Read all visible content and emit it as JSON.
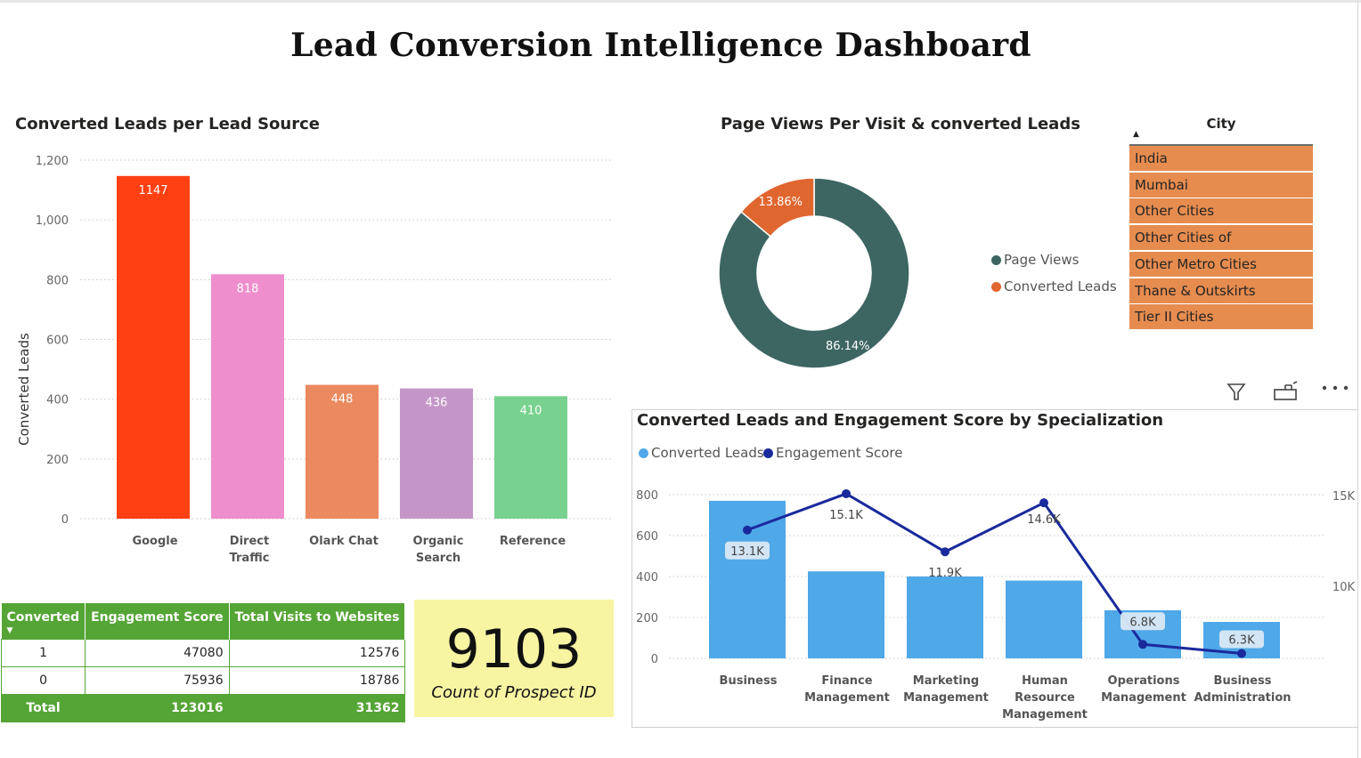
{
  "dashboard_title": "Lead Conversion Intelligence Dashboard",
  "lead_source_chart": {
    "title": "Converted Leads per Lead Source",
    "ylabel": "Converted Leads"
  },
  "donut_chart": {
    "title": "Page Views Per Visit & converted Leads"
  },
  "specialization_chart": {
    "title": "Converted Leads and Engagement Score by Specialization"
  },
  "city_slicer": {
    "title": "City",
    "items": [
      "India",
      "Mumbai",
      "Other Cities",
      "Other Cities of Maharashtra",
      "Other Metro Cities",
      "Thane & Outskirts",
      "Tier II Cities"
    ],
    "color": "#e68c4f"
  },
  "matrix": {
    "headers": [
      "Converted",
      "Engagement Score",
      "Total Visits to Websites"
    ],
    "rows": [
      {
        "key": "1",
        "engagement": "47080",
        "visits": "12576"
      },
      {
        "key": "0",
        "engagement": "75936",
        "visits": "18786"
      }
    ],
    "total": {
      "key": "Total",
      "engagement": "123016",
      "visits": "31362"
    },
    "header_color": "#55a536"
  },
  "card": {
    "value": "9103",
    "label": "Count of Prospect ID",
    "background": "#f7f4a2"
  },
  "toolbar_icons": [
    "filter-icon",
    "focus-mode-icon",
    "more-options-icon"
  ],
  "chart_data": [
    {
      "type": "bar",
      "title": "Converted Leads per Lead Source",
      "xlabel": "",
      "ylabel": "Converted Leads",
      "categories": [
        "Google",
        "Direct Traffic",
        "Olark Chat",
        "Organic Search",
        "Reference"
      ],
      "values": [
        1147,
        818,
        448,
        436,
        410
      ],
      "data_labels": [
        "1147",
        "818",
        "448",
        "436",
        "410"
      ],
      "colors": [
        "#ff4013",
        "#ef8ecd",
        "#ea8a5e",
        "#c496c8",
        "#78d18e"
      ],
      "ylim": [
        0,
        1200
      ],
      "yticks": [
        0,
        200,
        400,
        600,
        800,
        1000,
        1200
      ],
      "ytick_labels": [
        "0",
        "200",
        "400",
        "600",
        "800",
        "1,000",
        "1,200"
      ],
      "grid": true
    },
    {
      "type": "pie",
      "title": "Page Views Per Visit & converted Leads",
      "donut": true,
      "categories": [
        "Page Views",
        "Converted Leads"
      ],
      "values": [
        86.14,
        13.86
      ],
      "data_labels": [
        "86.14%",
        "13.86%"
      ],
      "colors": [
        "#3d6663",
        "#e0662f"
      ],
      "legend": "right"
    },
    {
      "type": "bar",
      "title": "Converted Leads and Engagement Score by Specialization",
      "categories": [
        "Business",
        "Finance Management",
        "Marketing Management",
        "Human Resource Management",
        "Operations Management",
        "Business Administration"
      ],
      "series": [
        {
          "name": "Converted Leads",
          "type": "bar",
          "axis": "left",
          "values": [
            770,
            425,
            400,
            380,
            235,
            178
          ],
          "color": "#4fa8e8"
        },
        {
          "name": "Engagement Score",
          "type": "line",
          "axis": "right",
          "values": [
            13100,
            15100,
            11900,
            14600,
            6800,
            6300
          ],
          "data_labels": [
            "13.1K",
            "15.1K",
            "11.9K",
            "14.6K",
            "6.8K",
            "6.3K"
          ],
          "color": "#1a2a9c"
        }
      ],
      "ylim": [
        0,
        800
      ],
      "yticks": [
        0,
        200,
        400,
        600,
        800
      ],
      "ytick_labels": [
        "0",
        "200",
        "400",
        "600",
        "800"
      ],
      "y2ticks": [
        10000,
        15000
      ],
      "y2tick_labels": [
        "10K",
        "15K"
      ],
      "legend": "top-left",
      "grid": true
    }
  ]
}
